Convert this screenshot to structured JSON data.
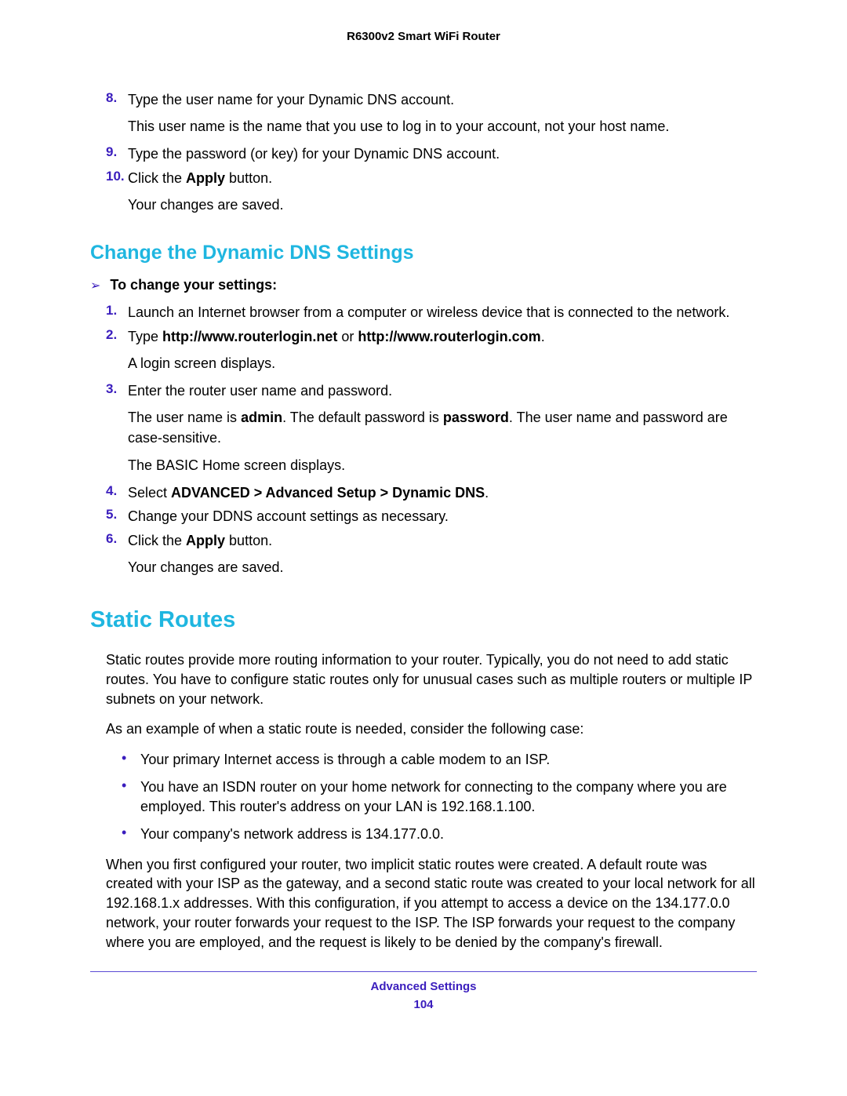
{
  "header": {
    "title": "R6300v2 Smart WiFi Router"
  },
  "intro_steps": [
    {
      "num": "8.",
      "text": "Type the user name for your Dynamic DNS account.",
      "follow": [
        "This user name is the name that you use to log in to your account, not your host name."
      ]
    },
    {
      "num": "9.",
      "text": "Type the password (or key) for your Dynamic DNS account.",
      "follow": []
    },
    {
      "num": "10.",
      "prefix": "Click the ",
      "bold": "Apply",
      "suffix": " button.",
      "follow": [
        "Your changes are saved."
      ]
    }
  ],
  "section1": {
    "title": "Change the Dynamic DNS Settings",
    "proc_label": "To change your settings:",
    "steps": [
      {
        "num": "1.",
        "text": "Launch an Internet browser from a computer or wireless device that is connected to the network.",
        "follow": []
      },
      {
        "num": "2.",
        "prefix": "Type ",
        "bold": "http://www.routerlogin.net",
        "mid": " or ",
        "bold2": "http://www.routerlogin.com",
        "suffix": ".",
        "follow": [
          "A login screen displays."
        ]
      },
      {
        "num": "3.",
        "text": "Enter the router user name and password.",
        "follow_html": [
          {
            "parts": [
              "The user name is ",
              {
                "b": "admin"
              },
              ". The default password is ",
              {
                "b": "password"
              },
              ". The user name and password are case-sensitive."
            ]
          },
          {
            "parts": [
              "The BASIC Home screen displays."
            ]
          }
        ]
      },
      {
        "num": "4.",
        "prefix": "Select ",
        "bold": "ADVANCED > Advanced Setup > Dynamic DNS",
        "suffix": ".",
        "follow": []
      },
      {
        "num": "5.",
        "text": "Change your DDNS account settings as necessary.",
        "follow": []
      },
      {
        "num": "6.",
        "prefix": "Click the ",
        "bold": "Apply",
        "suffix": " button.",
        "follow": [
          "Your changes are saved."
        ]
      }
    ]
  },
  "section2": {
    "title": "Static Routes",
    "para1": "Static routes provide more routing information to your router. Typically, you do not need to add static routes. You have to configure static routes only for unusual cases such as multiple routers or multiple IP subnets on your network.",
    "para2": "As an example of when a static route is needed, consider the following case:",
    "bullets": [
      "Your primary Internet access is through a cable modem to an ISP.",
      "You have an ISDN router on your home network for connecting to the company where you are employed. This router's address on your LAN is 192.168.1.100.",
      "Your company's network address is 134.177.0.0."
    ],
    "para3": "When you first configured your router, two implicit static routes were created. A default route was created with your ISP as the gateway, and a second static route was created to your local network for all 192.168.1.x addresses. With this configuration, if you attempt to access a device on the 134.177.0.0 network, your router forwards your request to the ISP. The ISP forwards your request to the company where you are employed, and the request is likely to be denied by the company's firewall."
  },
  "footer": {
    "section": "Advanced Settings",
    "page": "104"
  }
}
